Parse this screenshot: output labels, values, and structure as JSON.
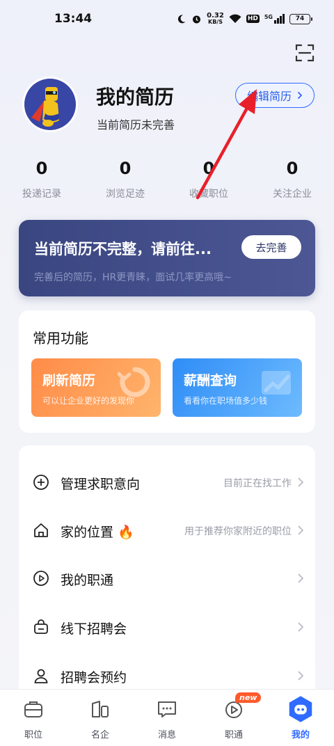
{
  "status_bar": {
    "time": "13:44",
    "net_speed_value": "0.32",
    "net_speed_unit": "KB/S",
    "hd_label": "HD",
    "signal_label": "5G",
    "battery": "74"
  },
  "profile": {
    "title": "我的简历",
    "subtitle": "当前简历未完善",
    "edit_button": "编辑简历"
  },
  "stats": [
    {
      "value": "0",
      "label": "投递记录"
    },
    {
      "value": "0",
      "label": "浏览足迹"
    },
    {
      "value": "0",
      "label": "收藏职位"
    },
    {
      "value": "0",
      "label": "关注企业"
    }
  ],
  "banner": {
    "title": "当前简历不完整，请前往...",
    "subtitle": "完善后的简历，HR更青睐，面试几率更高哦~",
    "button": "去完善"
  },
  "functions": {
    "title": "常用功能",
    "tiles": [
      {
        "title": "刷新简历",
        "subtitle": "可以让企业更好的发现你",
        "color": "#ff9650"
      },
      {
        "title": "薪酬查询",
        "subtitle": "看看你在职场值多少钱",
        "color": "#3a96f8"
      }
    ]
  },
  "menu": [
    {
      "icon": "plus-circle-icon",
      "label": "管理求职意向",
      "hint": "目前正在找工作"
    },
    {
      "icon": "home-icon",
      "label": "家的位置",
      "emoji": "🔥",
      "hint": "用于推荐你家附近的职位"
    },
    {
      "icon": "play-circle-icon",
      "label": "我的职通",
      "hint": ""
    },
    {
      "icon": "bag-icon",
      "label": "线下招聘会",
      "hint": ""
    },
    {
      "icon": "person-icon",
      "label": "招聘会预约",
      "hint": ""
    }
  ],
  "tabbar": {
    "active_index": 4,
    "tabs": [
      {
        "label": "职位",
        "icon": "briefcase-icon"
      },
      {
        "label": "名企",
        "icon": "company-icon"
      },
      {
        "label": "消息",
        "icon": "message-icon"
      },
      {
        "label": "职通",
        "icon": "play-icon",
        "badge": "new"
      },
      {
        "label": "我的",
        "icon": "robot-icon"
      }
    ]
  },
  "colors": {
    "accent": "#2f6bff",
    "banner": "#3f4a86",
    "annotation_arrow": "#e8202a"
  }
}
